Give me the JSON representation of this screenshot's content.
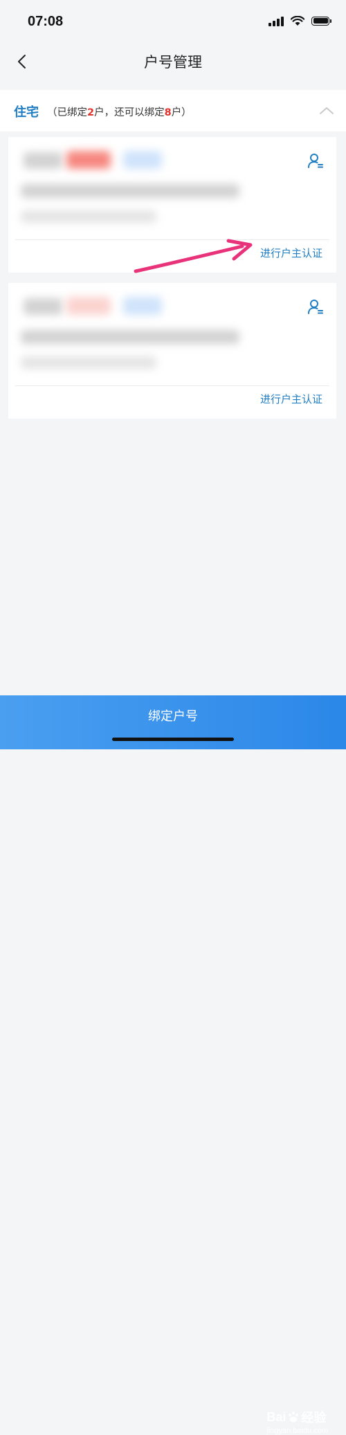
{
  "status": {
    "time": "07:08"
  },
  "nav": {
    "title": "户号管理"
  },
  "section": {
    "title": "住宅",
    "note_prefix": "（已绑定",
    "bound_count": "2",
    "note_middle": "户，还可以绑定",
    "remaining_count": "8",
    "note_suffix": "户）"
  },
  "cards": [
    {
      "verify_label": "进行户主认证"
    },
    {
      "verify_label": "进行户主认证"
    }
  ],
  "bottom": {
    "bind_button_label": "绑定户号"
  },
  "watermark": {
    "brand_left": "Bai",
    "brand_right": "经验",
    "url": "jingyan.baidu.com"
  },
  "colors": {
    "accent": "#1f7dc4",
    "count_red": "#e2322a",
    "button_blue": "#2b87e8",
    "arrow_pink": "#e8327a"
  }
}
